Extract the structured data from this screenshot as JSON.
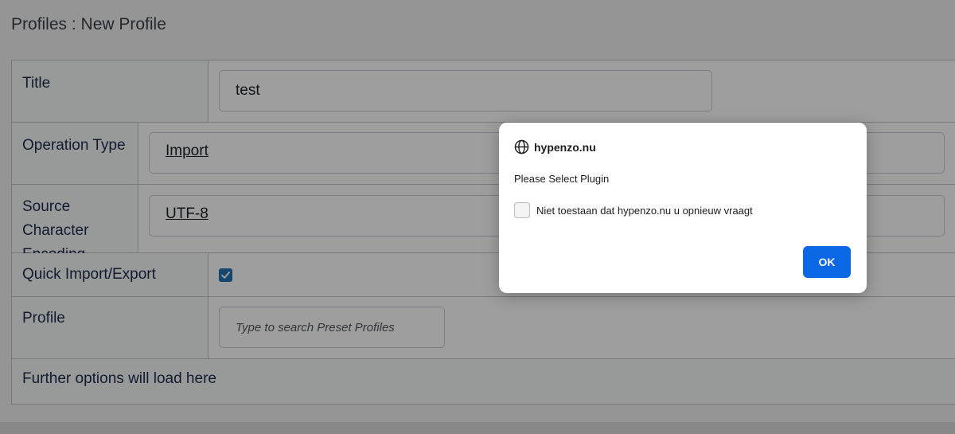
{
  "page": {
    "title": "Profiles : New Profile"
  },
  "form": {
    "title_label": "Title",
    "title_value": "test",
    "operation_label": "Operation Type",
    "operation_value": "Import",
    "encoding_label_line1": "Source Character",
    "encoding_label_line2": "Encoding",
    "encoding_value": "UTF-8",
    "quick_label": "Quick Import/Export",
    "quick_checked": true,
    "profile_label": "Profile",
    "profile_placeholder": "Type to search Preset Profiles",
    "further_options": "Further options will load here"
  },
  "dialog": {
    "site": "hypenzo.nu",
    "message": "Please Select Plugin",
    "checkbox_label": "Niet toestaan dat hypenzo.nu u opnieuw vraagt",
    "ok_label": "OK",
    "globe_icon": "globe-icon"
  },
  "colors": {
    "accent": "#2271b1",
    "ok_button": "#0a68e6"
  }
}
